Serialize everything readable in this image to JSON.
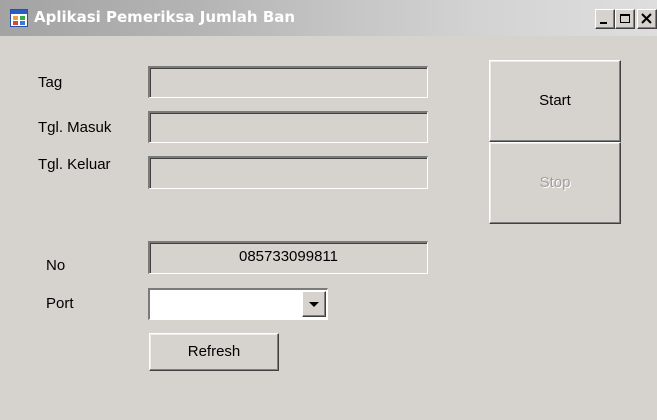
{
  "window": {
    "title": "Aplikasi Pemeriksa Jumlah Ban",
    "app_icon": "windows-form-icon",
    "controls": {
      "minimize_icon": "minimize-icon",
      "maximize_icon": "maximize-icon",
      "close_icon": "close-icon"
    }
  },
  "form": {
    "tag": {
      "label": "Tag",
      "value": ""
    },
    "tgl_masuk": {
      "label": "Tgl. Masuk",
      "value": ""
    },
    "tgl_keluar": {
      "label": "Tgl. Keluar",
      "value": ""
    },
    "no": {
      "label": "No",
      "value": "085733099811"
    },
    "port": {
      "label": "Port",
      "selected": "",
      "arrow_icon": "dropdown-arrow-icon"
    }
  },
  "buttons": {
    "start": {
      "label": "Start",
      "enabled": true
    },
    "stop": {
      "label": "Stop",
      "enabled": false
    },
    "refresh": {
      "label": "Refresh",
      "enabled": true
    }
  },
  "colors": {
    "form_background": "#d6d3ce",
    "titlebar_gradient_start": "#a3a3a3",
    "titlebar_gradient_end": "#dedede",
    "title_text": "#ffffff",
    "disabled_text": "#a0a0a0"
  }
}
